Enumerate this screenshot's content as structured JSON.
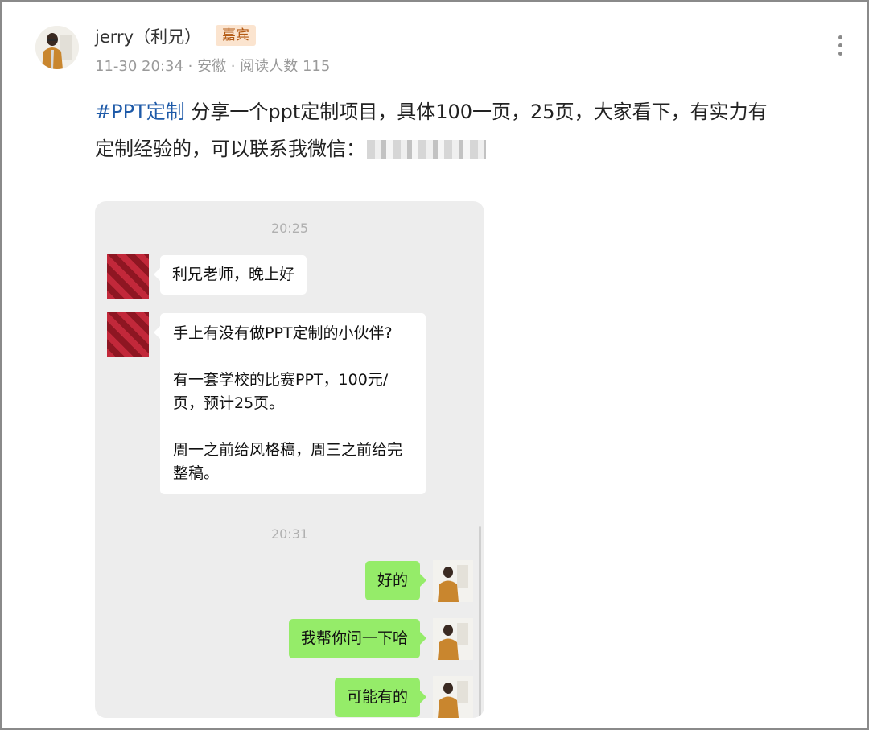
{
  "post": {
    "author": "jerry（利兄）",
    "badge": "嘉宾",
    "meta": "11-30 20:34 · 安徽 · 阅读人数 115",
    "hashtag": "#PPT定制",
    "body_line1": " 分享一个ppt定制项目，具体100一页，25页，大家看下，有实力有",
    "body_line2": "定制经验的，可以联系我微信："
  },
  "chat": {
    "time1": "20:25",
    "msg1": "利兄老师，晚上好",
    "msg2_p1": "手上有没有做PPT定制的小伙伴?",
    "msg2_p2": "有一套学校的比赛PPT，100元/页，预计25页。",
    "msg2_p3": "周一之前给风格稿，周三之前给完整稿。",
    "time2": "20:31",
    "reply1": "好的",
    "reply2": "我帮你问一下哈",
    "reply3": "可能有的"
  },
  "colors": {
    "hashtag": "#1e5aa8",
    "badge_bg": "#fbe4cf",
    "badge_text": "#b35a14",
    "bubble_out": "#95ec69",
    "chat_bg": "#ededed"
  },
  "icons": {
    "more": "more-vertical-icon"
  }
}
